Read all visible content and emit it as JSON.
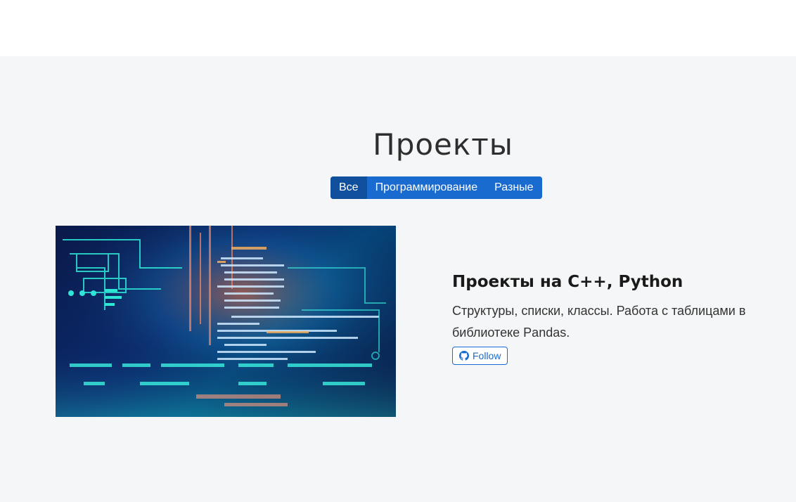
{
  "section": {
    "title": "Проекты"
  },
  "filters": [
    {
      "label": "Все",
      "active": true
    },
    {
      "label": "Программирование",
      "active": false
    },
    {
      "label": "Разные",
      "active": false
    }
  ],
  "project": {
    "title": "Проекты на С++, Python",
    "description": "Структуры, списки, классы. Работа с таблицами в библиотеке Pandas.",
    "follow_label": "Follow",
    "follow_icon": "github-icon",
    "image_icon": "code-screen-image"
  },
  "colors": {
    "accent": "#1a6bcf",
    "accent_active": "#104f9c",
    "section_bg": "#f5f6f7"
  }
}
